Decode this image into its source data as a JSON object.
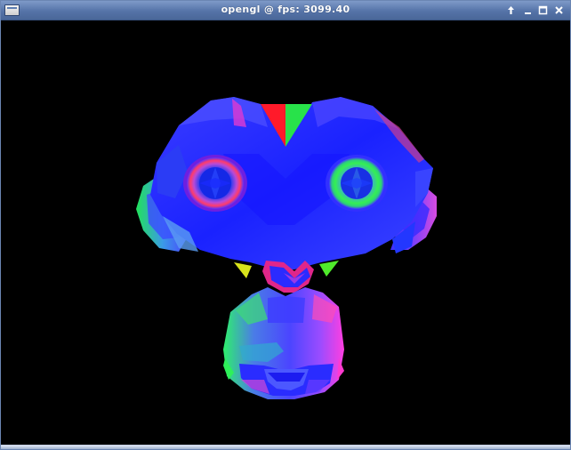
{
  "window": {
    "title": "opengl @ fps: 3099.40",
    "controls": [
      "up-arrow-icon",
      "minimize-icon",
      "maximize-icon",
      "close-icon"
    ]
  },
  "scene": {
    "model": "monkey-head-normals",
    "background_color": "#000000"
  }
}
